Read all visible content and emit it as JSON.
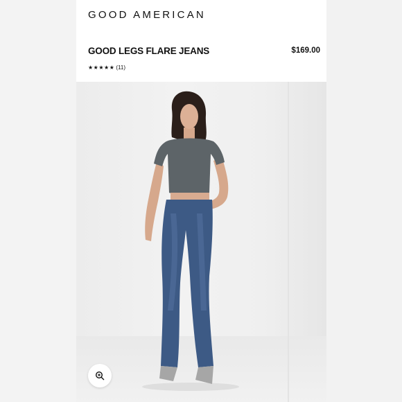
{
  "brand": {
    "name": "GOOD AMERICAN"
  },
  "product": {
    "title": "GOOD LEGS FLARE JEANS",
    "price": "$169.00",
    "rating": {
      "stars": "★★★★★",
      "review_count": "(11)",
      "value": 5
    }
  },
  "image": {
    "subject": "product-photo-model-flare-jeans",
    "colors": {
      "top": "#5d6468",
      "denim": "#3d5a85",
      "hair": "#2b1f1a",
      "skin": "#d8ab90",
      "boots": "#a6a6a6"
    }
  },
  "controls": {
    "zoom_icon": "zoom-in-icon"
  }
}
